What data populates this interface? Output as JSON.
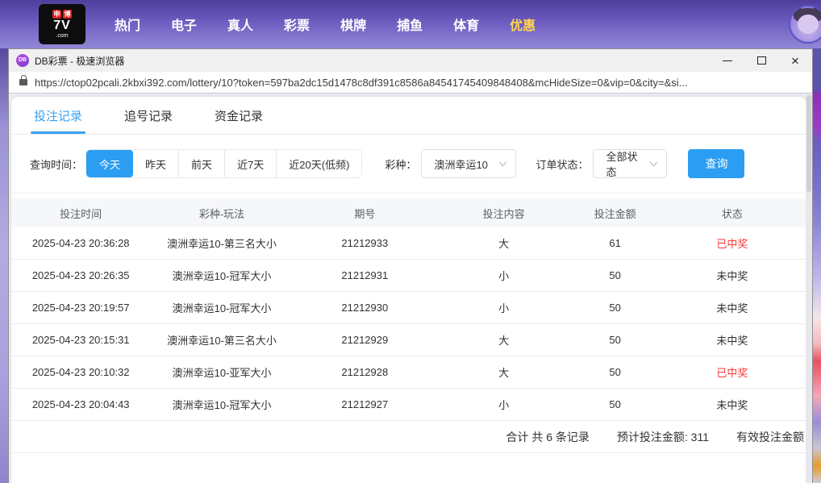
{
  "site_nav": {
    "logo": {
      "tiles": [
        "申",
        "博"
      ],
      "brand": "7V",
      "suffix": ".com"
    },
    "items": [
      {
        "label": "热门"
      },
      {
        "label": "电子"
      },
      {
        "label": "真人"
      },
      {
        "label": "彩票"
      },
      {
        "label": "棋牌"
      },
      {
        "label": "捕鱼"
      },
      {
        "label": "体育"
      },
      {
        "label": "优惠"
      }
    ]
  },
  "window": {
    "favicon": "DB",
    "title": "DB彩票 - 极速浏览器",
    "close_glyph": "×",
    "url": "https://ctop02pcali.2kbxi392.com/lottery/10?token=597ba2dc15d1478c8df391c8586a84541745409848408&mcHideSize=0&vip=0&city=&si..."
  },
  "tabs": [
    {
      "label": "投注记录",
      "active": true
    },
    {
      "label": "追号记录",
      "active": false
    },
    {
      "label": "资金记录",
      "active": false
    }
  ],
  "filters": {
    "time_label": "查询时间：",
    "time_options": [
      "今天",
      "昨天",
      "前天",
      "近7天",
      "近20天(低频)"
    ],
    "time_selected": "今天",
    "lottery_label": "彩种：",
    "lottery_value": "澳洲幸运10",
    "status_label": "订单状态：",
    "status_value": "全部状态",
    "query_button": "查询"
  },
  "table": {
    "columns": [
      "投注时间",
      "彩种-玩法",
      "期号",
      "投注内容",
      "投注金额",
      "状态"
    ],
    "rows": [
      {
        "time": "2025-04-23 20:36:28",
        "game": "澳洲幸运10-第三名大小",
        "issue": "21212933",
        "content": "大",
        "amount": "61",
        "status": "已中奖",
        "status_class": "st-won"
      },
      {
        "time": "2025-04-23 20:26:35",
        "game": "澳洲幸运10-冠军大小",
        "issue": "21212931",
        "content": "小",
        "amount": "50",
        "status": "未中奖",
        "status_class": "st-miss"
      },
      {
        "time": "2025-04-23 20:19:57",
        "game": "澳洲幸运10-冠军大小",
        "issue": "21212930",
        "content": "小",
        "amount": "50",
        "status": "未中奖",
        "status_class": "st-miss"
      },
      {
        "time": "2025-04-23 20:15:31",
        "game": "澳洲幸运10-第三名大小",
        "issue": "21212929",
        "content": "大",
        "amount": "50",
        "status": "未中奖",
        "status_class": "st-miss"
      },
      {
        "time": "2025-04-23 20:10:32",
        "game": "澳洲幸运10-亚军大小",
        "issue": "21212928",
        "content": "大",
        "amount": "50",
        "status": "已中奖",
        "status_class": "st-won"
      },
      {
        "time": "2025-04-23 20:04:43",
        "game": "澳洲幸运10-冠军大小",
        "issue": "21212927",
        "content": "小",
        "amount": "50",
        "status": "未中奖",
        "status_class": "st-miss"
      }
    ]
  },
  "summary": {
    "total_records": "合计 共 6 条记录",
    "expected_amount": "预计投注金额: 311",
    "valid_amount_label": "有效投注金额"
  },
  "colors": {
    "accent_blue": "#2b9ef3",
    "tab_active": "#3aa0f0",
    "won_red": "#f23a3a",
    "nav_highlight": "#ffd34d"
  }
}
